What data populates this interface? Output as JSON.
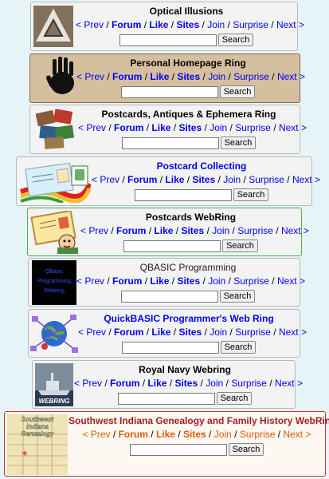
{
  "nav": {
    "prev": "< Prev",
    "forum": "Forum",
    "like": "Like",
    "sites": "Sites",
    "join": "Join",
    "surprise": "Surprise",
    "next": "Next >",
    "sep": "/"
  },
  "search_label": "Search",
  "colors": {
    "page_bg": "#e6f4f8",
    "link": "#0000ee",
    "card_bg": "#f3f3f3",
    "tan_card_bg": "#d6bf9e",
    "genealogy_accent": "#a02020",
    "blue_title": "#0000ee",
    "green_border": "#4caf50"
  },
  "rings": [
    {
      "title": "Optical Illusions",
      "thumb": "impossible-triangle-icon"
    },
    {
      "title": "Personal Homepage Ring",
      "thumb": "handprint-icon"
    },
    {
      "title": "Postcards, Antiques & Ephemera Ring",
      "thumb": "postcard-collage-icon"
    },
    {
      "title": "Postcard Collecting",
      "thumb": "postcard-stamp-icon"
    },
    {
      "title": "Postcards WebRing",
      "thumb": "postcard-cartoon-icon"
    },
    {
      "title": "QBASIC Programming",
      "thumb": "qbasic-logo-icon",
      "thumb_text": "QBasic Programming Webring"
    },
    {
      "title": "QuickBASIC Programmer's Web Ring",
      "thumb": "globe-network-icon"
    },
    {
      "title": "Royal Navy Webring",
      "thumb": "warship-icon",
      "thumb_text": "WEBRING"
    },
    {
      "title": "Southwest Indiana Genealogy and Family History WebRing",
      "thumb": "indiana-map-icon",
      "thumb_text": "Southwest Indiana Genealogy"
    }
  ]
}
